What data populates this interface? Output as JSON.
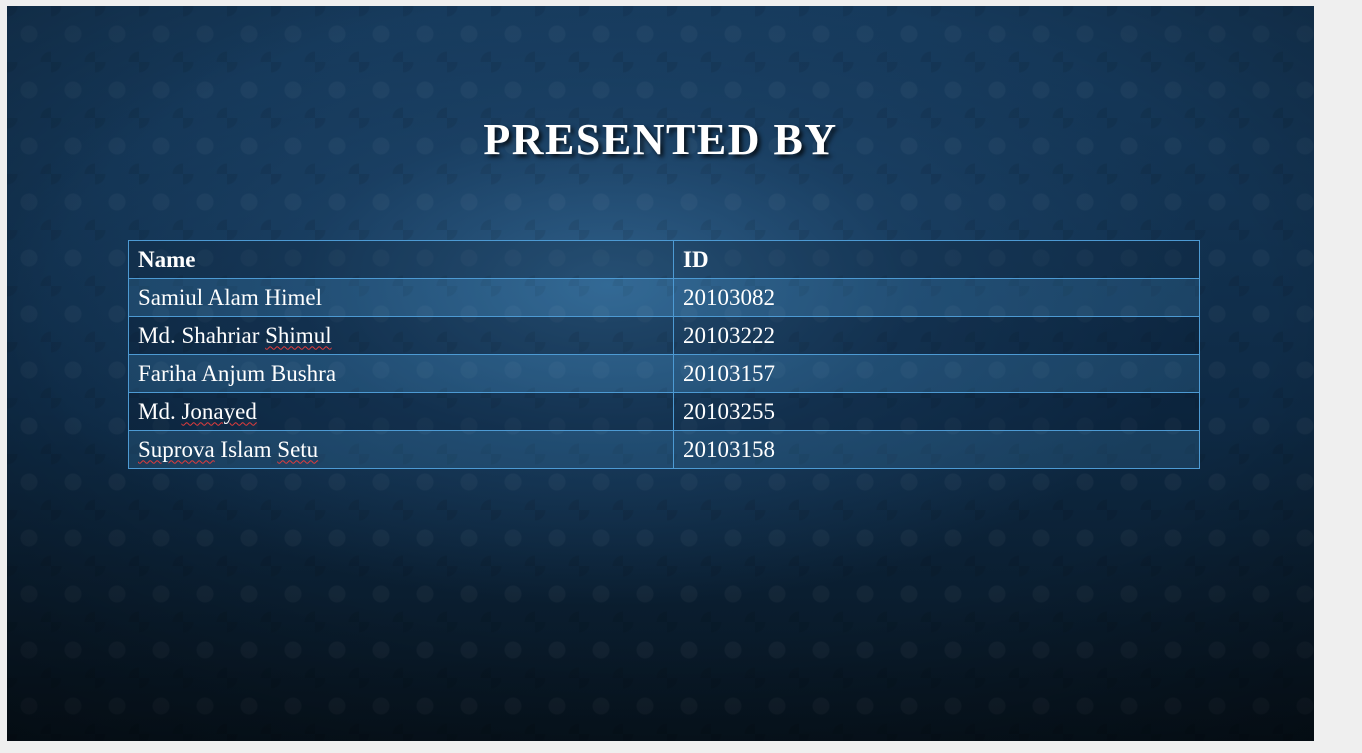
{
  "slide": {
    "title": "PRESENTED BY"
  },
  "table": {
    "headers": {
      "name": "Name",
      "id": "ID"
    },
    "rows": [
      {
        "name_a": "Samiul Alam Himel",
        "name_b": "",
        "name_c": "",
        "id": "20103082"
      },
      {
        "name_a": "Md. Shahriar ",
        "name_b": "Shimul",
        "name_c": "",
        "id": "20103222"
      },
      {
        "name_a": "Fariha Anjum Bushra",
        "name_b": "",
        "name_c": "",
        "id": "20103157"
      },
      {
        "name_a": "Md. ",
        "name_b": "Jonayed",
        "name_c": "",
        "id": "20103255"
      },
      {
        "name_a": "",
        "name_b": "Suprova",
        "name_c": " Islam ",
        "name_d": "Setu",
        "id": "20103158"
      }
    ]
  }
}
